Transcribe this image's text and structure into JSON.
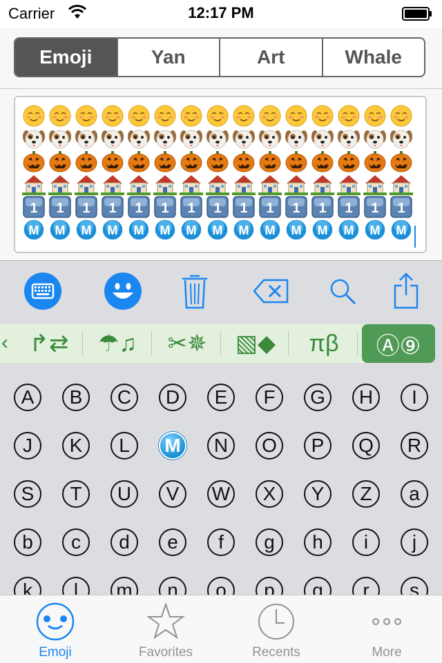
{
  "status_bar": {
    "carrier": "Carrier",
    "time": "12:17 PM"
  },
  "segments": [
    {
      "label": "Emoji",
      "active": true
    },
    {
      "label": "Yan",
      "active": false
    },
    {
      "label": "Art",
      "active": false
    },
    {
      "label": "Whale",
      "active": false
    }
  ],
  "preview": {
    "rows": [
      "smiling-face",
      "dog-face",
      "jack-o-lantern",
      "house",
      "keycap-1",
      "circled-M"
    ],
    "per_row": 15,
    "keycap_text": "1",
    "badge_text": "M"
  },
  "toolbar": [
    "keyboard-icon",
    "smiley-icon",
    "trash-icon",
    "delete-backspace-icon",
    "search-icon",
    "share-icon"
  ],
  "categories": {
    "items": [
      {
        "label": "↱⇄",
        "active": false
      },
      {
        "label": "☂♫",
        "active": false
      },
      {
        "label": "✂✵",
        "active": false
      },
      {
        "label": "▧◆",
        "active": false
      },
      {
        "label": "πβ",
        "active": false
      },
      {
        "label": "Ⓐ⑨",
        "active": true
      }
    ]
  },
  "keys": [
    "A",
    "B",
    "C",
    "D",
    "E",
    "F",
    "G",
    "H",
    "I",
    "J",
    "K",
    "L",
    "M",
    "N",
    "O",
    "P",
    "Q",
    "R",
    "S",
    "T",
    "U",
    "V",
    "W",
    "X",
    "Y",
    "Z",
    "a",
    "b",
    "c",
    "d",
    "e",
    "f",
    "g",
    "h",
    "i",
    "j",
    "k",
    "l",
    "m",
    "n",
    "o",
    "p",
    "q",
    "r",
    "s"
  ],
  "selected_key": "M",
  "tabs": [
    {
      "label": "Emoji",
      "icon": "happy-face-icon",
      "active": true
    },
    {
      "label": "Favorites",
      "icon": "star-icon",
      "active": false
    },
    {
      "label": "Recents",
      "icon": "clock-icon",
      "active": false
    },
    {
      "label": "More",
      "icon": "more-icon",
      "active": false
    }
  ],
  "colors": {
    "accent": "#1a86f0",
    "category_green": "#4f9a55",
    "segment_active": "#555555"
  }
}
